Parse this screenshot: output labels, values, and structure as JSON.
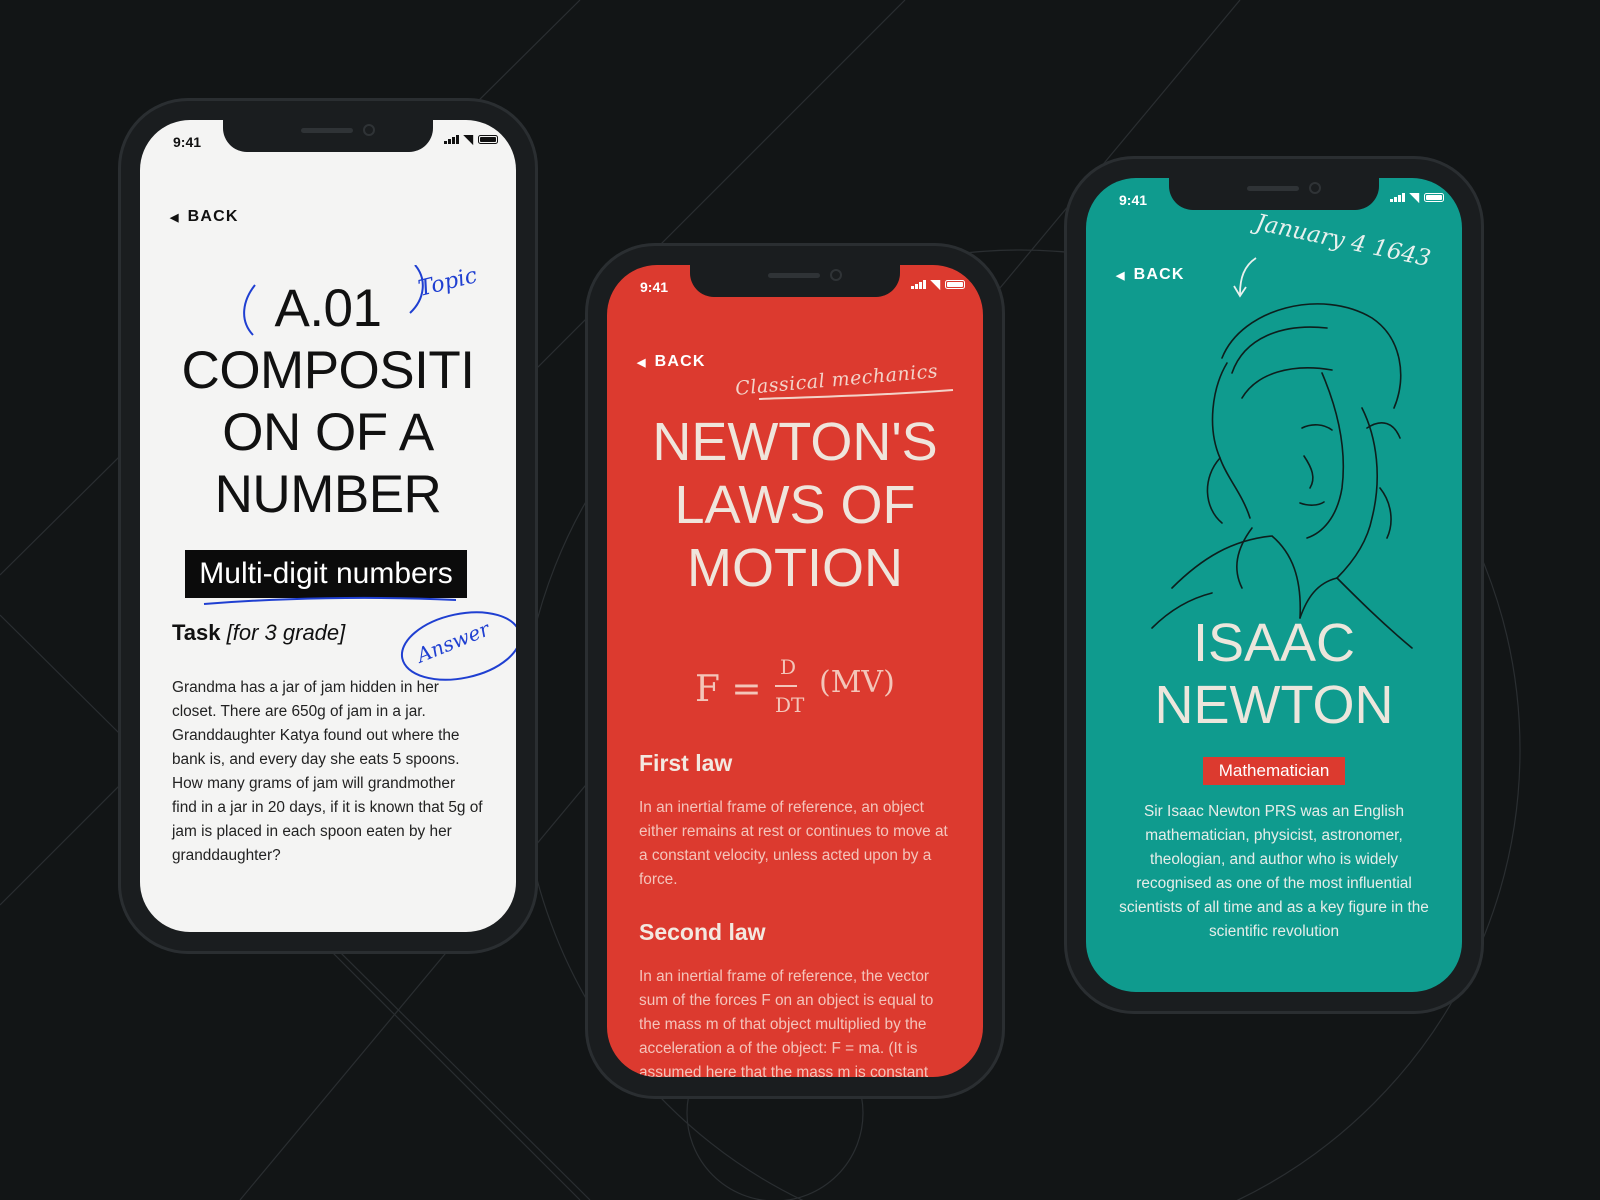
{
  "colors": {
    "background": "#121516",
    "phone1_screen": "#f4f4f3",
    "phone2_screen": "#dc3a2f",
    "phone3_screen": "#0f9b8e",
    "annotation_blue": "#1f3fd1",
    "badge_red": "#dc3a2f"
  },
  "phone1": {
    "status_time": "9:41",
    "back_label": "BACK",
    "topic_number": "A.01",
    "title_lines": [
      "COMPOSITI",
      "ON OF A",
      "NUMBER"
    ],
    "badge": "Multi-digit numbers",
    "task_label": "Task",
    "task_grade": "[for 3 grade]",
    "body": "Grandma has a jar of jam hidden in her closet. There are 650g of jam in a jar. Granddaughter Katya found out where the bank is, and every day she eats 5 spoons. How many grams of jam will grandmother find in a jar in 20 days, if it is known that 5g of jam is placed in each spoon eaten by her granddaughter?",
    "note_topic": "Topic",
    "note_answer": "Answer"
  },
  "phone2": {
    "status_time": "9:41",
    "back_label": "BACK",
    "note_subject": "Classical mechanics",
    "title_lines": [
      "NEWTON'S",
      "LAWS OF",
      "MOTION"
    ],
    "formula_left": "F =",
    "formula_num": "D",
    "formula_den": "DT",
    "formula_right": "(MV)",
    "first_law_heading": "First law",
    "first_law_text": "In an inertial frame of reference, an object either remains at rest or continues to move at a constant velocity, unless acted upon by a force.",
    "second_law_heading": "Second law",
    "second_law_text": "In an inertial frame of reference, the vector sum of the forces F on an object is equal to the mass m of that object multiplied by the acceleration a of the object: F = ma. (It is assumed here that the mass m is constant"
  },
  "phone3": {
    "status_time": "9:41",
    "back_label": "BACK",
    "note_date": "January 4 1643",
    "title_lines": [
      "ISAAC",
      "NEWTON"
    ],
    "badge": "Mathematician",
    "body": "Sir Isaac Newton PRS was an English mathematician, physicist, astronomer, theologian, and author who is widely recognised as one of the most influential scientists of all time and as a key figure in the scientific revolution"
  }
}
